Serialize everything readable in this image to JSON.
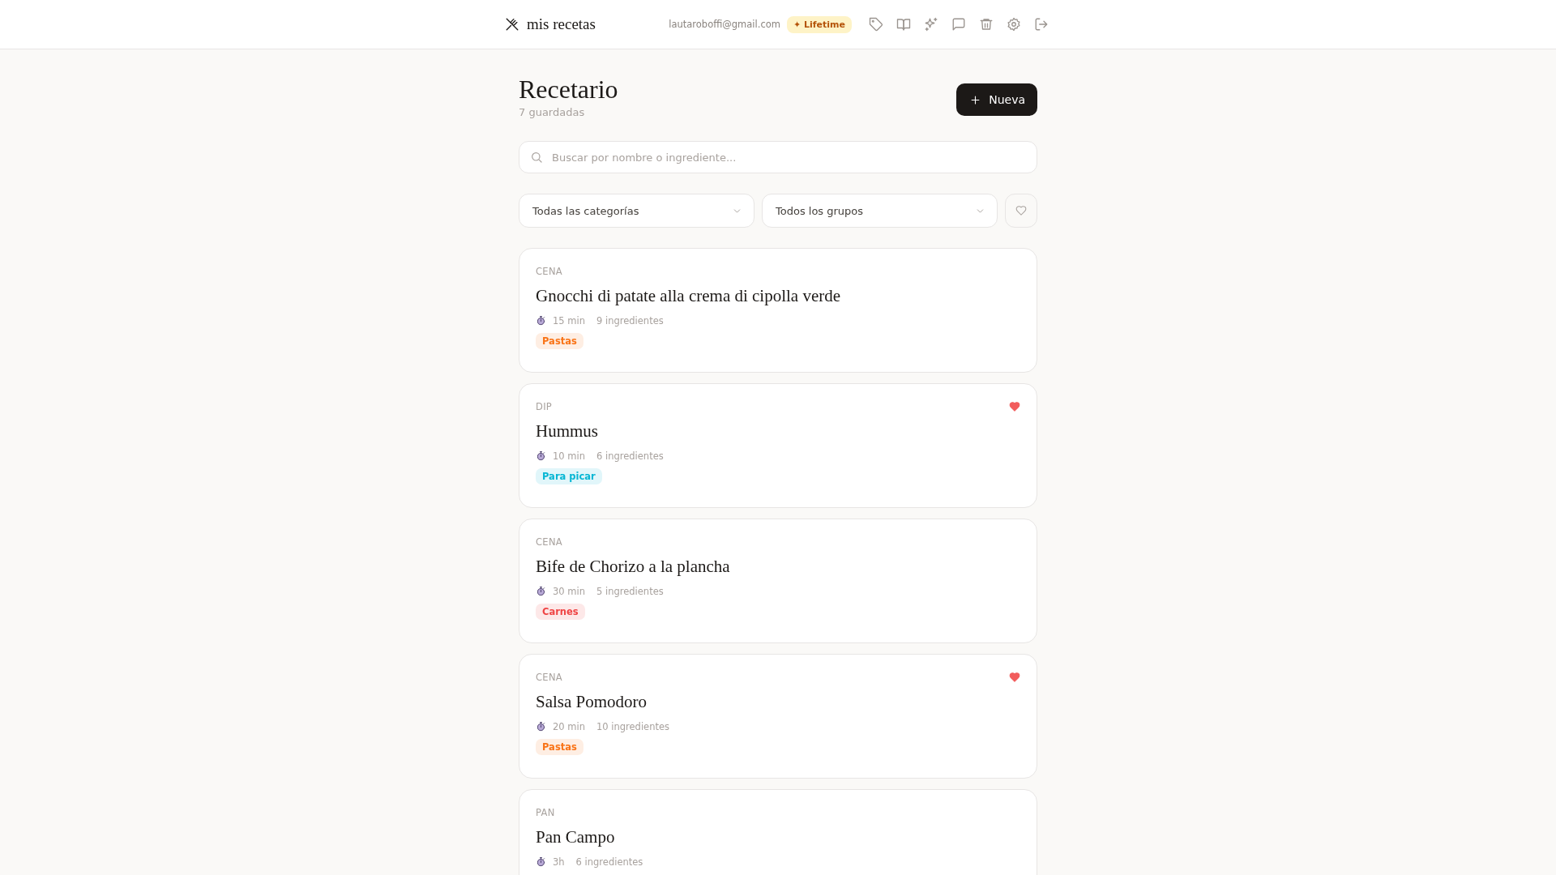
{
  "header": {
    "brand": "mis recetas",
    "email": "lautaroboffi@gmail.com",
    "plan_badge": "✦ Lifetime",
    "icons": [
      {
        "kind": "tag"
      },
      {
        "kind": "book"
      },
      {
        "kind": "sparkles"
      },
      {
        "kind": "chat"
      },
      {
        "kind": "trash"
      },
      {
        "kind": "settings"
      },
      {
        "kind": "logout"
      }
    ]
  },
  "page": {
    "title": "Recetario",
    "subtitle": "7 guardadas",
    "new_button": "Nueva"
  },
  "search": {
    "placeholder": "Buscar por nombre o ingrediente..."
  },
  "filters": [
    {
      "value": "Todas las categorías"
    },
    {
      "value": "Todos los grupos"
    }
  ],
  "favorites_filter": {
    "on": false
  },
  "recipes": [
    {
      "category": "CENA",
      "title": "Gnocchi di patate alla crema di cipolla verde",
      "time": "15 min",
      "ingredients": "9 ingredientes",
      "favorite": false,
      "tag": {
        "label": "Pastas",
        "color": "#f97316"
      }
    },
    {
      "category": "DIP",
      "title": "Hummus",
      "time": "10 min",
      "ingredients": "6 ingredientes",
      "favorite": true,
      "tag": {
        "label": "Para picar",
        "color": "#06b6d4"
      }
    },
    {
      "category": "CENA",
      "title": "Bife de Chorizo a la plancha",
      "time": "30 min",
      "ingredients": "5 ingredientes",
      "favorite": false,
      "tag": {
        "label": "Carnes",
        "color": "#ef4444"
      }
    },
    {
      "category": "CENA",
      "title": "Salsa Pomodoro",
      "time": "20 min",
      "ingredients": "10 ingredientes",
      "favorite": true,
      "tag": {
        "label": "Pastas",
        "color": "#f97316"
      }
    },
    {
      "category": "PAN",
      "title": "Pan Campo",
      "time": "3h",
      "ingredients": "6 ingredientes",
      "favorite": false
    }
  ]
}
